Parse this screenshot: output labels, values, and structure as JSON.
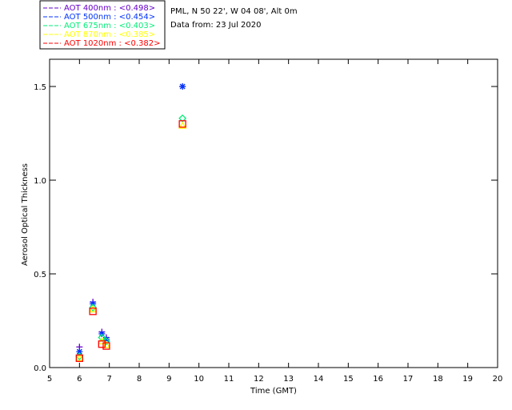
{
  "chart_data": {
    "type": "scatter",
    "header": {
      "line1": "PML, N 50 22', W 04 08', Alt 0m",
      "line2": "Data from: 23 Jul 2020"
    },
    "xlabel": "Time (GMT)",
    "ylabel": "Aerosol Optical Thickness",
    "xlim": [
      5,
      20
    ],
    "ylim": [
      0,
      1.65
    ],
    "xticks": [
      5,
      6,
      7,
      8,
      9,
      10,
      11,
      12,
      13,
      14,
      15,
      16,
      17,
      18,
      19,
      20
    ],
    "yticks": [
      0.0,
      0.5,
      1.0,
      1.5
    ],
    "ytick_labels": [
      "0.0",
      "0.5",
      "1.0",
      "1.5"
    ],
    "grid": false,
    "legend_placement": "top-left outside",
    "series": [
      {
        "name": "AOT  400nm : <0.498>",
        "color": "#6600cc",
        "marker": "plus",
        "x": [
          6.0,
          6.45,
          6.75,
          6.9,
          9.45
        ],
        "y": [
          0.11,
          0.35,
          0.19,
          0.16,
          1.5
        ]
      },
      {
        "name": "AOT  500nm : <0.454>",
        "color": "#0033ff",
        "marker": "asterisk",
        "x": [
          6.0,
          6.45,
          6.75,
          6.9,
          9.45
        ],
        "y": [
          0.085,
          0.34,
          0.18,
          0.15,
          1.5
        ]
      },
      {
        "name": "AOT  675nm : <0.403>",
        "color": "#00ee77",
        "marker": "diamond",
        "x": [
          6.0,
          6.45,
          6.75,
          6.9,
          9.45
        ],
        "y": [
          0.06,
          0.32,
          0.16,
          0.14,
          1.33
        ]
      },
      {
        "name": "AOT  870nm : <0.385>",
        "color": "#ffff00",
        "marker": "triangle",
        "x": [
          6.0,
          6.45,
          6.75,
          6.9,
          9.45
        ],
        "y": [
          0.05,
          0.31,
          0.14,
          0.12,
          1.29
        ]
      },
      {
        "name": "AOT 1020nm : <0.382>",
        "color": "#ff0000",
        "marker": "square",
        "x": [
          6.0,
          6.45,
          6.75,
          6.9,
          9.45
        ],
        "y": [
          0.05,
          0.3,
          0.125,
          0.115,
          1.3
        ]
      }
    ]
  }
}
